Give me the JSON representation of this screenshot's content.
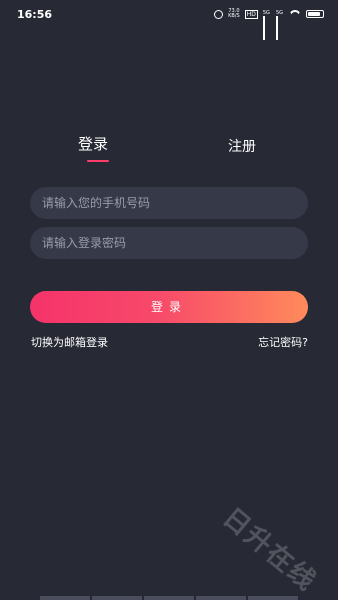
{
  "status_bar": {
    "time": "16:56",
    "net_speed_value": "73.0",
    "net_speed_unit": "KB/S",
    "hd": "HD",
    "sig_label": "5G",
    "sig2_label": "5G",
    "battery_level": 0.85
  },
  "tabs": {
    "login": "登录",
    "register": "注册"
  },
  "form": {
    "phone_placeholder": "请输入您的手机号码",
    "password_placeholder": "请输入登录密码",
    "login_button": "登录"
  },
  "links": {
    "email_login": "切换为邮箱登录",
    "forgot_password": "忘记密码?"
  },
  "watermark": "日升在线",
  "colors": {
    "background": "#272a35",
    "accent": "#ff3d6a",
    "gradient_end": "#ff8a5b",
    "field_bg": "#353948"
  }
}
